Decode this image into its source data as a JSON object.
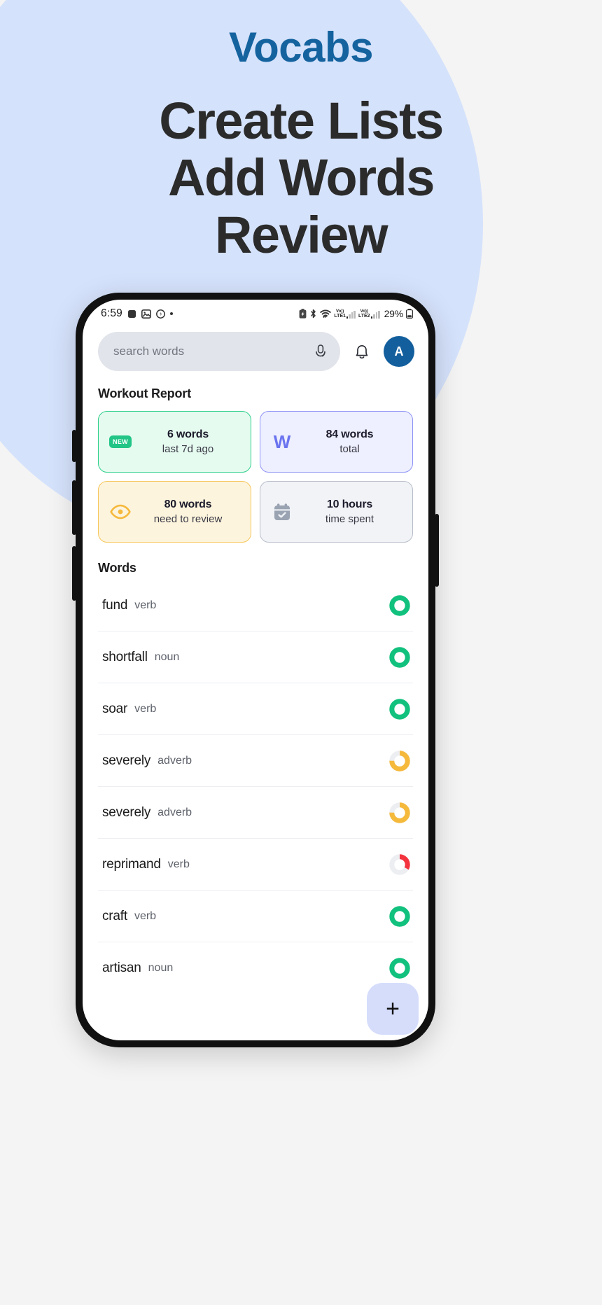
{
  "hero": {
    "brand": "Vocabs",
    "lines": [
      "Create Lists",
      "Add Words",
      "Review"
    ]
  },
  "colors": {
    "brand_blue": "#14639f",
    "blob": "#d5e2fb",
    "green": "#22c586",
    "indigo": "#6b74ef",
    "yellow": "#f5b93c",
    "red": "#f3343f",
    "avatar_bg": "#135f9d"
  },
  "statusbar": {
    "clock": "6:59",
    "icons_left": [
      "stop-square-icon",
      "photo-icon",
      "clock-circle-icon",
      "dot-icon"
    ],
    "icons_right": [
      "battery-saver-icon",
      "bluetooth-icon",
      "wifi-icon"
    ],
    "sim1_label": "Vo))",
    "sim1_tech": "LTE1",
    "sim2_label": "Vo))",
    "sim2_tech": "LTE2",
    "battery_percent": "29%"
  },
  "header": {
    "search_placeholder": "search words",
    "mic_icon": "microphone-icon",
    "bell_icon": "bell-icon",
    "avatar_initial": "A"
  },
  "report": {
    "title": "Workout Report",
    "cards": [
      {
        "icon": "new-badge-icon",
        "icon_text": "NEW",
        "value": "6 words",
        "label": "last 7d ago",
        "theme": "green"
      },
      {
        "icon": "w-letter-icon",
        "icon_text": "W",
        "value": "84 words",
        "label": "total",
        "theme": "indigo"
      },
      {
        "icon": "eye-icon",
        "icon_text": "",
        "value": "80 words",
        "label": "need to review",
        "theme": "yellow"
      },
      {
        "icon": "calendar-check-icon",
        "icon_text": "",
        "value": "10 hours",
        "label": "time spent",
        "theme": "gray"
      }
    ]
  },
  "words": {
    "title": "Words",
    "items": [
      {
        "term": "fund",
        "pos": "verb",
        "progress": 100,
        "ring_color": "#11c17d"
      },
      {
        "term": "shortfall",
        "pos": "noun",
        "progress": 100,
        "ring_color": "#11c17d"
      },
      {
        "term": "soar",
        "pos": "verb",
        "progress": 100,
        "ring_color": "#11c17d"
      },
      {
        "term": "severely",
        "pos": "adverb",
        "progress": 75,
        "ring_color": "#f5b93c"
      },
      {
        "term": "severely",
        "pos": "adverb",
        "progress": 75,
        "ring_color": "#f5b93c"
      },
      {
        "term": "reprimand",
        "pos": "verb",
        "progress": 33,
        "ring_color": "#f3343f"
      },
      {
        "term": "craft",
        "pos": "verb",
        "progress": 100,
        "ring_color": "#11c17d"
      },
      {
        "term": "artisan",
        "pos": "noun",
        "progress": 100,
        "ring_color": "#11c17d"
      }
    ]
  },
  "fab": {
    "icon": "plus-icon",
    "label": "+"
  }
}
